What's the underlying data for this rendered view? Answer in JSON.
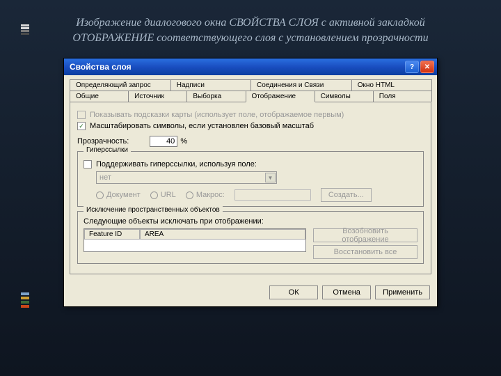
{
  "caption": "Изображение диалогового окна СВОЙСТВА СЛОЯ с активной закладкой ОТОБРАЖЕНИЕ соответствующего слоя с установлением прозрачности",
  "dialog": {
    "title": "Свойства слоя",
    "help_label": "?",
    "close_label": "✕",
    "tabs_row1": [
      "Определяющий запрос",
      "Надписи",
      "Соединения и Связи",
      "Окно HTML"
    ],
    "tabs_row2": [
      "Общие",
      "Источник",
      "Выборка",
      "Отображение",
      "Символы",
      "Поля"
    ],
    "show_tips_label": "Показывать подсказки карты (использует поле, отображаемое первым)",
    "scale_symbols_label": "Масштабировать символы, если установлен базовый масштаб",
    "transparency_label": "Прозрачность:",
    "transparency_value": "40",
    "transparency_unit": "%",
    "hyperlinks": {
      "title": "Гиперссылки",
      "support_label": "Поддерживать гиперссылки, используя поле:",
      "field_value": "нет",
      "radio_doc": "Документ",
      "radio_url": "URL",
      "radio_macro": "Макрос:",
      "create_btn": "Создать..."
    },
    "exclusion": {
      "title": "Исключение пространственных объектов",
      "subtitle": "Следующие объекты исключать при отображении:",
      "col1": "Feature ID",
      "col2": "AREA",
      "restore_btn": "Возобновить отображение",
      "restore_all_btn": "Восстановить все"
    },
    "ok": "ОК",
    "cancel": "Отмена",
    "apply": "Применить"
  }
}
